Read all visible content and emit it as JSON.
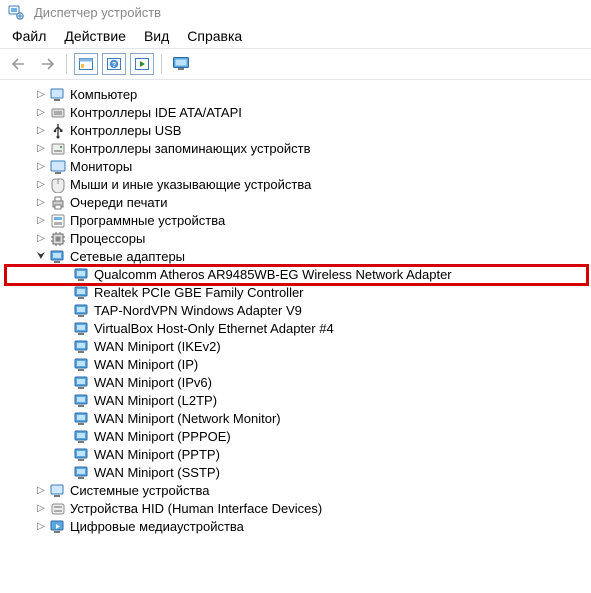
{
  "window": {
    "title": "Диспетчер устройств"
  },
  "menu": {
    "file": "Файл",
    "action": "Действие",
    "view": "Вид",
    "help": "Справка"
  },
  "tree": {
    "cat": {
      "computer": "Компьютер",
      "ide": "Контроллеры IDE ATA/ATAPI",
      "usb": "Контроллеры USB",
      "storage": "Контроллеры запоминающих устройств",
      "monitors": "Мониторы",
      "mice": "Мыши и иные указывающие устройства",
      "printq": "Очереди печати",
      "software": "Программные устройства",
      "cpu": "Процессоры",
      "net": "Сетевые адаптеры",
      "system": "Системные устройства",
      "hid": "Устройства HID (Human Interface Devices)",
      "media": "Цифровые медиаустройства"
    },
    "net": {
      "i0": "Qualcomm Atheros AR9485WB-EG Wireless Network Adapter",
      "i1": "Realtek PCIe GBE Family Controller",
      "i2": "TAP-NordVPN Windows Adapter V9",
      "i3": "VirtualBox Host-Only Ethernet Adapter #4",
      "i4": "WAN Miniport (IKEv2)",
      "i5": "WAN Miniport (IP)",
      "i6": "WAN Miniport (IPv6)",
      "i7": "WAN Miniport (L2TP)",
      "i8": "WAN Miniport (Network Monitor)",
      "i9": "WAN Miniport (PPPOE)",
      "i10": "WAN Miniport (PPTP)",
      "i11": "WAN Miniport (SSTP)"
    }
  }
}
